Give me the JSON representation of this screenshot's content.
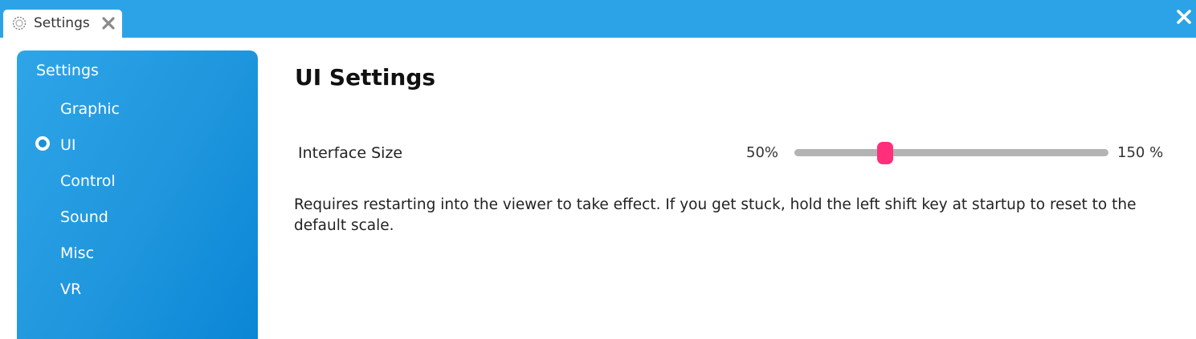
{
  "tab": {
    "title": "Settings",
    "icon": "gear-icon"
  },
  "sidebar": {
    "title": "Settings",
    "selected": "UI",
    "items": [
      {
        "label": "Graphic"
      },
      {
        "label": "UI"
      },
      {
        "label": "Control"
      },
      {
        "label": "Sound"
      },
      {
        "label": "Misc"
      },
      {
        "label": "VR"
      }
    ]
  },
  "main": {
    "title": "UI Settings",
    "interface_size": {
      "label": "Interface Size",
      "min_label": "50%",
      "max_label": "150 %",
      "min": 50,
      "max": 150,
      "value": 79
    },
    "note": "Requires restarting into the viewer to take effect. If you get stuck, hold the left shift key at startup to reset to the default scale."
  },
  "colors": {
    "accent": "#2ca3e6",
    "slider_thumb": "#ff2f7c",
    "slider_track": "#b3b3b3"
  }
}
